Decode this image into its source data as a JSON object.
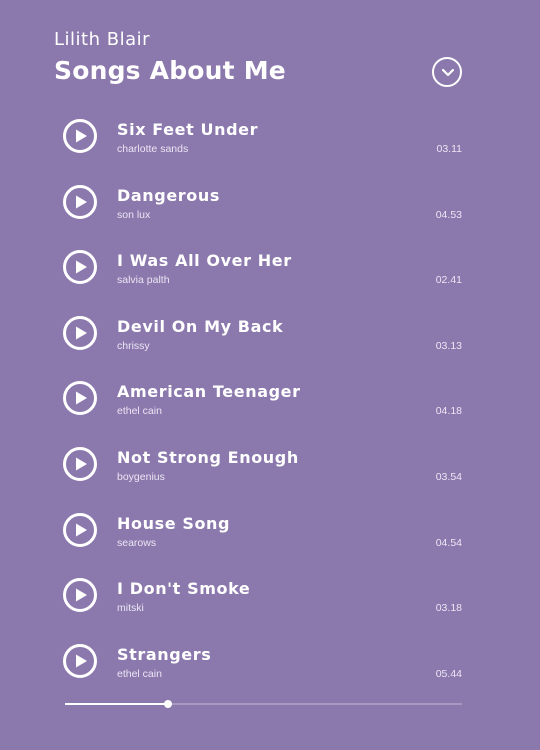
{
  "header": {
    "user_name": "Lilith Blair",
    "playlist_title": "Songs About Me",
    "collapse_icon": "chevron-down-icon"
  },
  "tracks": [
    {
      "title": "Six Feet Under",
      "artist": "charlotte sands",
      "duration": "03.11"
    },
    {
      "title": "Dangerous",
      "artist": "son lux",
      "duration": "04.53"
    },
    {
      "title": "I Was All Over Her",
      "artist": "salvia palth",
      "duration": "02.41"
    },
    {
      "title": "Devil On My Back",
      "artist": "chrissy",
      "duration": "03.13"
    },
    {
      "title": "American Teenager",
      "artist": "ethel cain",
      "duration": "04.18"
    },
    {
      "title": "Not Strong Enough",
      "artist": "boygenius",
      "duration": "03.54"
    },
    {
      "title": "House Song",
      "artist": "searows",
      "duration": "04.54"
    },
    {
      "title": "I Don't Smoke",
      "artist": "mitski",
      "duration": "03.18"
    },
    {
      "title": "Strangers",
      "artist": "ethel cain",
      "duration": "05.44"
    }
  ],
  "playback": {
    "progress_fraction": 0.26
  },
  "colors": {
    "background": "#8b78ad",
    "text": "#ffffff",
    "progress_track": "#a797c2"
  },
  "icons": {
    "track_play": "play-circle-icon"
  }
}
